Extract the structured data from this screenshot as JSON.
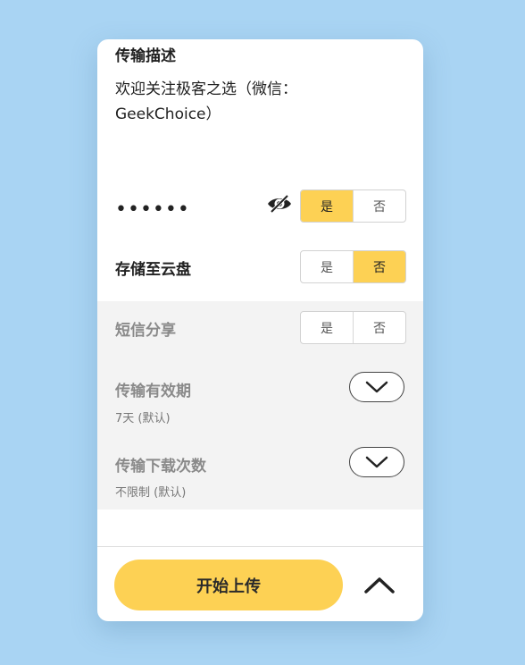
{
  "description": {
    "title": "传输描述",
    "text": "欢迎关注极客之选（微信：\nGeekChoice）"
  },
  "password": {
    "masked_value": "••••••",
    "visibility_icon": "eye-slash-icon",
    "toggle": {
      "yes_label": "是",
      "no_label": "否",
      "selected": "是"
    }
  },
  "cloud_save": {
    "label": "存储至云盘",
    "toggle": {
      "yes_label": "是",
      "no_label": "否",
      "selected": "否"
    }
  },
  "sms_share": {
    "label": "短信分享",
    "toggle": {
      "yes_label": "是",
      "no_label": "否",
      "selected": "none"
    }
  },
  "validity": {
    "label": "传输有效期",
    "value": "7天 (默认)",
    "icon": "chevron-down-icon"
  },
  "download_limit": {
    "label": "传输下载次数",
    "value": "不限制 (默认)",
    "icon": "chevron-down-icon"
  },
  "footer": {
    "upload_label": "开始上传",
    "collapse_icon": "chevron-up-icon"
  },
  "colors": {
    "accent": "#fdd154",
    "background": "#a9d4f3",
    "card": "#ffffff",
    "disabled_block": "#f3f3f3"
  }
}
